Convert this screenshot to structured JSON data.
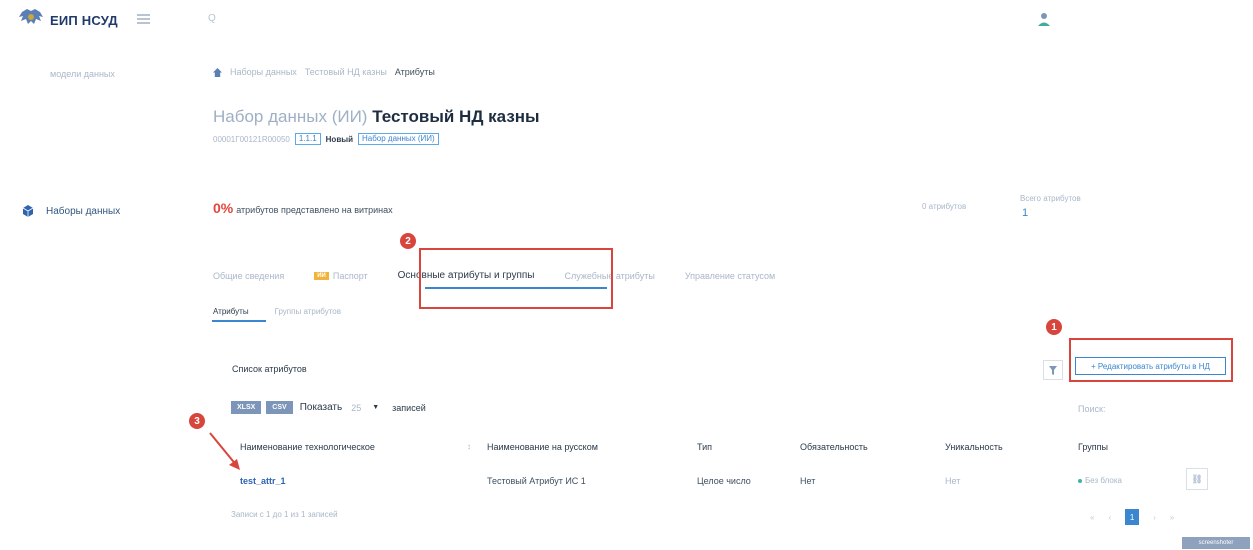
{
  "app": {
    "logo_text": "ЕИП НСУД",
    "search_placeholder": "Q"
  },
  "sidebar": {
    "section_label": "модели данных",
    "items": [
      {
        "label": "Наборы данных",
        "icon": "cube-icon"
      }
    ]
  },
  "breadcrumb": {
    "items": [
      "Наборы данных",
      "Тестовый НД казны"
    ],
    "current": "Атрибуты"
  },
  "header": {
    "title_prefix": "Набор данных (ИИ)",
    "title_name": "Тестовый НД казны",
    "code": "00001Г00121R00050",
    "version": "1.1.1",
    "status": "Новый",
    "type_badge": "Набор данных (ИИ)"
  },
  "stats": {
    "percent": "0%",
    "percent_text": "атрибутов представлено на витринах",
    "attr_count_label": "0 атрибутов",
    "total_label": "Всего атрибутов",
    "total_value": "1"
  },
  "tabs": [
    {
      "label": "Общие сведения"
    },
    {
      "label": "Паспорт",
      "badge": "ИИ"
    },
    {
      "label": "Основные атрибуты и группы",
      "active": true
    },
    {
      "label": "Служебные атрибуты"
    },
    {
      "label": "Управление статусом"
    }
  ],
  "subtabs": [
    {
      "label": "Атрибуты",
      "active": true
    },
    {
      "label": "Группы атрибутов"
    }
  ],
  "list": {
    "title": "Список атрибутов",
    "edit_button": "+ Редактировать атрибуты в НД",
    "export_xlsx": "XLSX",
    "export_csv": "CSV",
    "show_label": "Показать",
    "show_value": "25",
    "records_label": "записей",
    "search_label": "Поиск:",
    "footer_info": "Записи с 1 до 1 из 1 записей",
    "current_page": "1"
  },
  "table": {
    "columns": [
      "Наименование технологическое",
      "Наименование на русском",
      "Тип",
      "Обязательность",
      "Уникальность",
      "Группы"
    ],
    "sort_indicator": "↕",
    "rows": [
      {
        "tech_name": "test_attr_1",
        "ru_name": "Тестовый Атрибут ИС 1",
        "type": "Целое число",
        "required": "Нет",
        "unique": "Нет",
        "group": "Без блока"
      }
    ]
  },
  "annotations": {
    "marker_1": "1",
    "marker_2": "2",
    "marker_3": "3"
  },
  "watermark": "screenshoter",
  "colors": {
    "accent": "#3a86cf",
    "highlight": "#d8453c",
    "percent": "#e2463e",
    "passport_badge": "#f2b33a"
  }
}
